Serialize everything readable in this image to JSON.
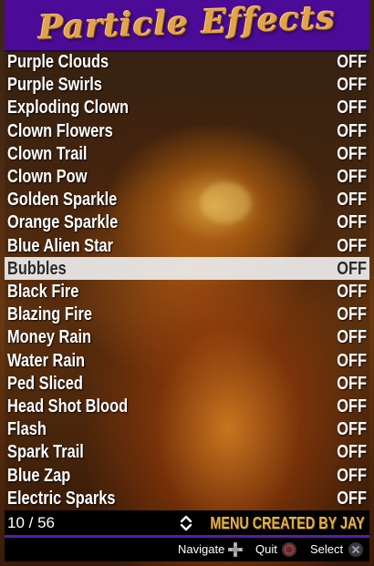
{
  "header": {
    "title": "Particle Effects"
  },
  "menu": {
    "items": [
      {
        "label": "Purple Clouds",
        "value": "OFF"
      },
      {
        "label": "Purple Swirls",
        "value": "OFF"
      },
      {
        "label": "Exploding Clown",
        "value": "OFF"
      },
      {
        "label": "Clown Flowers",
        "value": "OFF"
      },
      {
        "label": "Clown Trail",
        "value": "OFF"
      },
      {
        "label": "Clown Pow",
        "value": "OFF"
      },
      {
        "label": "Golden Sparkle",
        "value": "OFF"
      },
      {
        "label": "Orange Sparkle",
        "value": "OFF"
      },
      {
        "label": "Blue Alien Star",
        "value": "OFF"
      },
      {
        "label": "Bubbles",
        "value": "OFF",
        "selected": true
      },
      {
        "label": "Black Fire",
        "value": "OFF"
      },
      {
        "label": "Blazing Fire",
        "value": "OFF"
      },
      {
        "label": "Money Rain",
        "value": "OFF"
      },
      {
        "label": "Water Rain",
        "value": "OFF"
      },
      {
        "label": "Ped Sliced",
        "value": "OFF"
      },
      {
        "label": "Head Shot Blood",
        "value": "OFF"
      },
      {
        "label": "Flash",
        "value": "OFF"
      },
      {
        "label": "Spark Trail",
        "value": "OFF"
      },
      {
        "label": "Blue Zap",
        "value": "OFF"
      },
      {
        "label": "Electric Sparks",
        "value": "OFF"
      }
    ]
  },
  "footer": {
    "counter": "10 / 56",
    "credit": "MENU CREATED BY JAY",
    "scroll_icon": "up-down-arrows-icon"
  },
  "buttons": {
    "navigate": {
      "label": "Navigate",
      "icon": "dpad-icon"
    },
    "quit": {
      "label": "Quit",
      "icon": "circle-button-icon"
    },
    "select": {
      "label": "Select",
      "icon": "cross-button-icon"
    }
  },
  "colors": {
    "header_bg": "#4b0b96",
    "title": "#e0a34a",
    "credit": "#e3b24a",
    "selected_bg": "#ebebeb",
    "quit_icon": "#d0242c"
  }
}
